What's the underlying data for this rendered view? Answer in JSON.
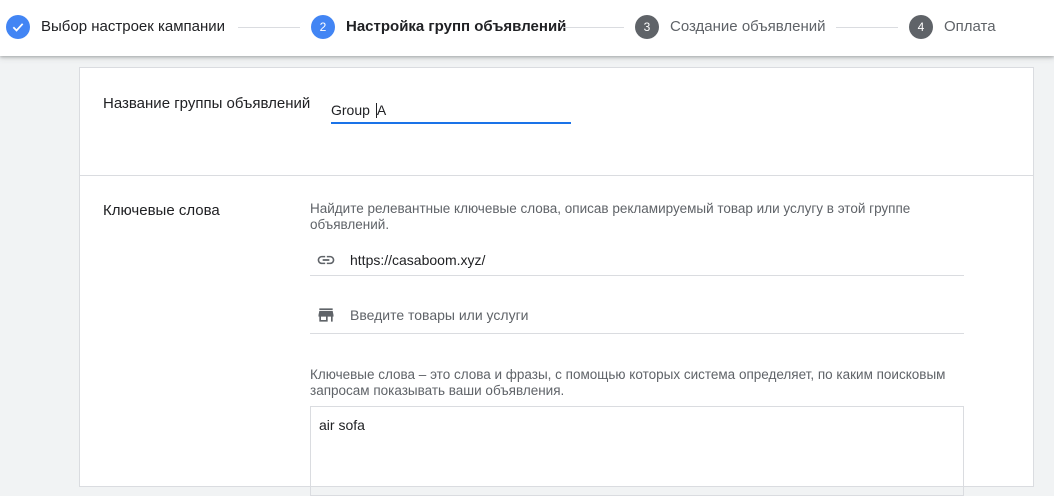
{
  "stepper": {
    "steps": [
      {
        "number": "1",
        "label": "Выбор настроек кампании",
        "state": "done"
      },
      {
        "number": "2",
        "label": "Настройка групп объявлений",
        "state": "current"
      },
      {
        "number": "3",
        "label": "Создание объявлений",
        "state": "upcoming"
      },
      {
        "number": "4",
        "label": "Оплата",
        "state": "upcoming"
      }
    ]
  },
  "ad_group": {
    "name_label": "Название группы объявлений",
    "name_value": "Group A"
  },
  "keywords": {
    "section_label": "Ключевые слова",
    "intro_text": "Найдите релевантные ключевые слова, описав рекламируемый товар или услугу в этой группе объявлений.",
    "url_icon": "link-icon",
    "url_value": "https://casaboom.xyz/",
    "products_icon": "store-icon",
    "products_placeholder": "Введите товары или услуги",
    "explanation_text": "Ключевые слова – это слова и фразы, с помощью которых система определяет, по каким поисковым запросам показывать ваши объявления.",
    "keywords_value": "air sofa"
  },
  "colors": {
    "accent": "#4285f4",
    "focus_underline": "#1a73e8",
    "inactive_badge": "#5f6368"
  }
}
